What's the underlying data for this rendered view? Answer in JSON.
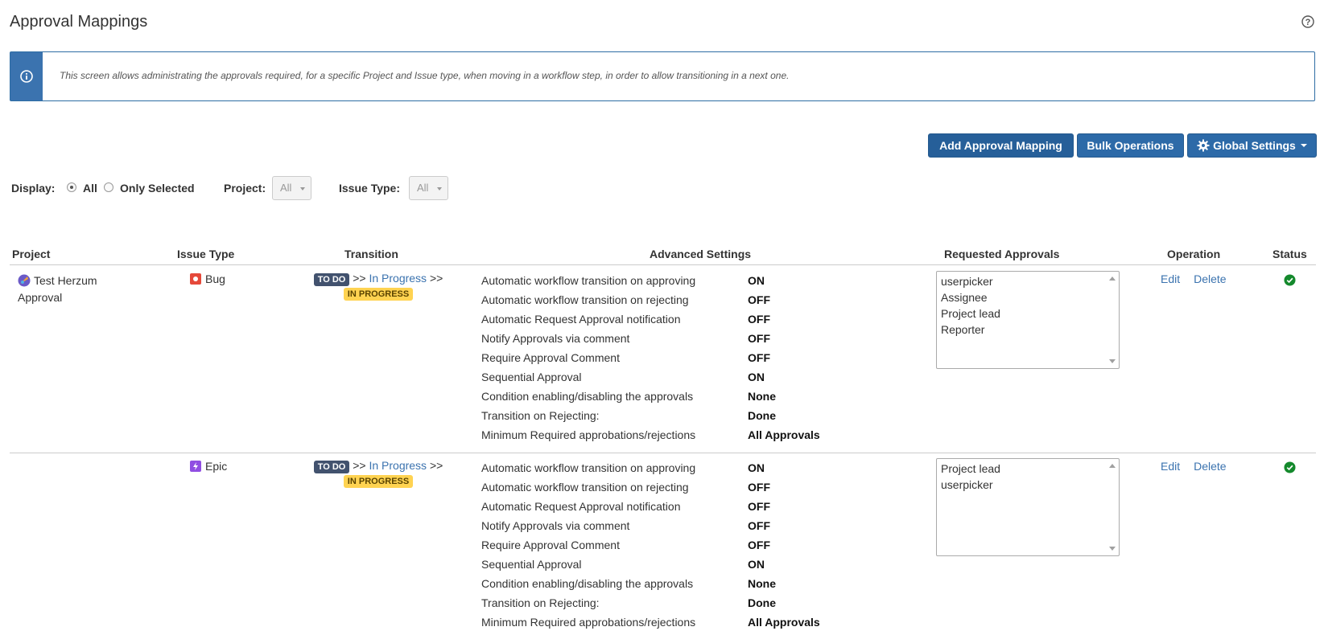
{
  "page": {
    "title": "Approval Mappings",
    "info_text": "This screen allows administrating the approvals required, for a specific Project and Issue type, when moving in a workflow step, in order to allow transitioning in a next one."
  },
  "toolbar": {
    "add_label": "Add Approval Mapping",
    "bulk_label": "Bulk Operations",
    "global_label": "Global Settings"
  },
  "filters": {
    "display_label": "Display:",
    "all_label": "All",
    "only_selected_label": "Only Selected",
    "display_selected": "All",
    "project_label": "Project:",
    "project_value": "All",
    "issue_type_label": "Issue Type:",
    "issue_type_value": "All"
  },
  "table": {
    "headers": {
      "project": "Project",
      "issue_type": "Issue Type",
      "transition": "Transition",
      "advanced": "Advanced Settings",
      "approvals": "Requested Approvals",
      "operation": "Operation",
      "status": "Status"
    },
    "rows": [
      {
        "project": "Test Herzum Approval",
        "issue_type": "Bug",
        "transition": {
          "from": "TO DO",
          "sep1": ">>",
          "name": "In Progress",
          "sep2": ">>",
          "to": "IN PROGRESS"
        },
        "settings": [
          {
            "label": "Automatic workflow transition on approving",
            "value": "ON"
          },
          {
            "label": "Automatic workflow transition on rejecting",
            "value": "OFF"
          },
          {
            "label": "Automatic Request Approval notification",
            "value": "OFF"
          },
          {
            "label": "Notify Approvals via comment",
            "value": "OFF"
          },
          {
            "label": "Require Approval Comment",
            "value": "OFF"
          },
          {
            "label": "Sequential Approval",
            "value": "ON"
          },
          {
            "label": "Condition enabling/disabling the approvals",
            "value": "None"
          },
          {
            "label": "Transition on Rejecting:",
            "value": "Done"
          },
          {
            "label": "Minimum Required approbations/rejections",
            "value": "All Approvals"
          }
        ],
        "approvals": [
          "userpicker",
          "Assignee",
          "Project lead",
          "Reporter"
        ],
        "edit": "Edit",
        "delete": "Delete",
        "status_icon": "check-circle-icon",
        "status_color": "#14892c"
      },
      {
        "project": "",
        "issue_type": "Epic",
        "transition": {
          "from": "TO DO",
          "sep1": ">>",
          "name": "In Progress",
          "sep2": ">>",
          "to": "IN PROGRESS"
        },
        "settings": [
          {
            "label": "Automatic workflow transition on approving",
            "value": "ON"
          },
          {
            "label": "Automatic workflow transition on rejecting",
            "value": "OFF"
          },
          {
            "label": "Automatic Request Approval notification",
            "value": "OFF"
          },
          {
            "label": "Notify Approvals via comment",
            "value": "OFF"
          },
          {
            "label": "Require Approval Comment",
            "value": "OFF"
          },
          {
            "label": "Sequential Approval",
            "value": "ON"
          },
          {
            "label": "Condition enabling/disabling the approvals",
            "value": "None"
          },
          {
            "label": "Transition on Rejecting:",
            "value": "Done"
          },
          {
            "label": "Minimum Required approbations/rejections",
            "value": "All Approvals"
          }
        ],
        "approvals": [
          "Project lead",
          "userpicker"
        ],
        "edit": "Edit",
        "delete": "Delete",
        "status_icon": "check-circle-icon",
        "status_color": "#14892c"
      }
    ]
  },
  "colors": {
    "primary": "#2d6aa8",
    "link": "#3b73af",
    "lozenge_todo": "#42526e",
    "lozenge_in_progress": "#ffd351",
    "bug_icon": "#e5493a",
    "epic_icon": "#904ee2"
  }
}
